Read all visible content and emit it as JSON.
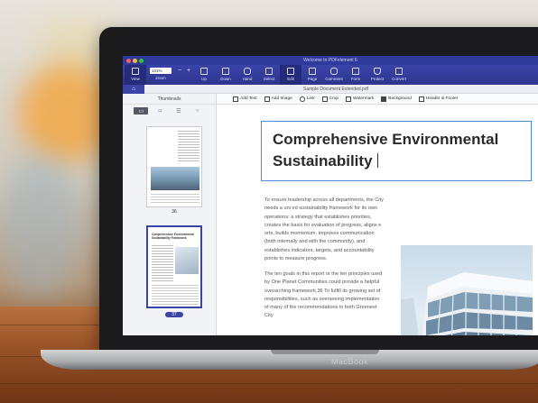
{
  "app": {
    "window_title": "Welcome to PDFelement 6",
    "toolbar": [
      {
        "label": "View",
        "icon": "view-icon",
        "active": true
      },
      {
        "label": "Zoom",
        "icon": "zoom-icon"
      },
      {
        "label": "Up",
        "icon": "up-arrow-icon"
      },
      {
        "label": "Down",
        "icon": "down-arrow-icon"
      },
      {
        "label": "Hand",
        "icon": "hand-icon"
      },
      {
        "label": "Select",
        "icon": "select-icon"
      },
      {
        "label": "Edit",
        "icon": "edit-icon"
      },
      {
        "label": "Page",
        "icon": "page-icon"
      },
      {
        "label": "Comment",
        "icon": "comment-icon"
      },
      {
        "label": "Form",
        "icon": "form-icon"
      },
      {
        "label": "Protect",
        "icon": "protect-icon"
      },
      {
        "label": "Convert",
        "icon": "convert-icon"
      }
    ],
    "zoom_value": "101%",
    "doc_tab": "Sample Document Extended.pdf",
    "edit_tools": [
      {
        "label": "Add Text",
        "icon": "add-text-icon"
      },
      {
        "label": "Add Image",
        "icon": "add-image-icon"
      },
      {
        "label": "Link",
        "icon": "link-icon"
      },
      {
        "label": "Crop",
        "icon": "crop-icon"
      },
      {
        "label": "Watermark",
        "icon": "watermark-icon"
      },
      {
        "label": "Background",
        "icon": "background-icon"
      },
      {
        "label": "Header & Footer",
        "icon": "header-footer-icon"
      }
    ]
  },
  "sidebar": {
    "title": "Thumbnails",
    "thumbnails": [
      {
        "page": "36"
      },
      {
        "page": "37",
        "selected": true,
        "title": "Comprehensive Environmental Sustainability Framework"
      }
    ]
  },
  "document": {
    "heading_line1": "Comprehensive Environmental",
    "heading_line2": "Sustainability",
    "paragraph1": "To ensure leadership across all departments, the City needs a uni ed sustainability framework for its own operations: a strategy that establishes priorities, creates the basis for evaluation of progress, aligns e orts, builds momentum, improves communication (both internally and with the community), and establishes indicators, targets, and accountability points to measure progress.",
    "paragraph2": "The ten goals in this report or the ten principles used by One Planet Communities could provide a helpful overarching framework.36 To fulfill its growing set of responsibilities, such as overseeing implementation of many of the recommendations in both Greenest City"
  },
  "laptop": {
    "brand": "MacBook"
  },
  "colors": {
    "toolbar": "#2d358e",
    "accent": "#3a44a8",
    "selection_border": "#4a8de0"
  }
}
